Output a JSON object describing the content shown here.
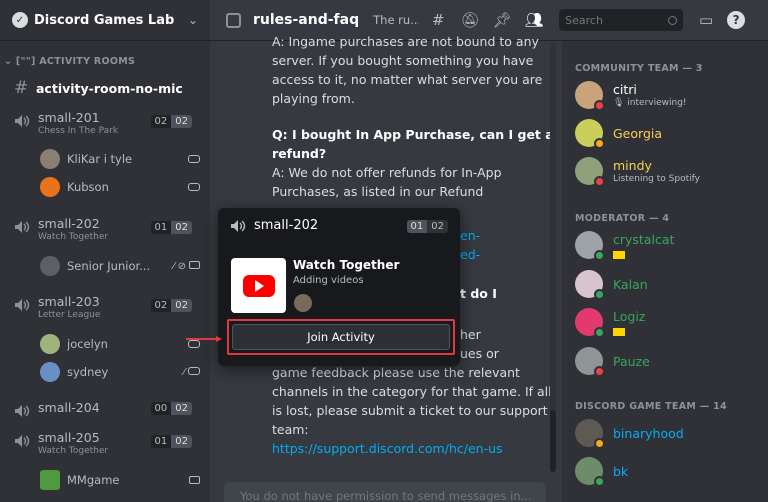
{
  "sidebar": {
    "server_name": "Discord Games Lab",
    "category": "ACTIVITY ROOMS",
    "category_prefix": "[\"\"]",
    "text_channel": "activity-room-no-mic",
    "voice_channels": [
      {
        "name": "small-201",
        "subtitle": "Chess In The Park",
        "count_a": "02",
        "count_b": "02",
        "users": [
          {
            "name": "KliKar i tyle"
          },
          {
            "name": "Kubson"
          }
        ]
      },
      {
        "name": "small-202",
        "subtitle": "Watch Together",
        "count_a": "01",
        "count_b": "02",
        "users": [
          {
            "name": "Senior Junior..."
          }
        ]
      },
      {
        "name": "small-203",
        "subtitle": "Letter League",
        "count_a": "02",
        "count_b": "02",
        "users": [
          {
            "name": "jocelyn"
          },
          {
            "name": "sydney"
          }
        ]
      },
      {
        "name": "small-204",
        "subtitle": "",
        "count_a": "00",
        "count_b": "02",
        "users": []
      },
      {
        "name": "small-205",
        "subtitle": "Watch Together",
        "count_a": "01",
        "count_b": "02",
        "users": [
          {
            "name": "MMgame"
          }
        ]
      }
    ]
  },
  "topbar": {
    "channel_name": "rules-and-faq",
    "topic": "The ru...",
    "search_placeholder": "Search"
  },
  "messages": {
    "p1": "A: Ingame purchases are not bound to any server. If you bought something you have access to it, no matter what server you are playing from.",
    "q2": "Q: I bought In App Purchase, can I get a refund?",
    "a2": "A: We do not offer refunds for In-App Purchases, as listed in our Refund",
    "frag_link1": "en-",
    "frag_link2": "ed-",
    "frag_q3": "t do I",
    "frag_l1": "her",
    "frag_l2": "ues or",
    "p3": "game feedback please use the relevant channels in the category for that game. If all is lost, please submit a ticket to our support team:",
    "link": "https://support.discord.com/hc/en-us",
    "composer_placeholder": "You do not have permission to send messages in..."
  },
  "members": {
    "groups": [
      {
        "label": "COMMUNITY TEAM — 3",
        "members": [
          {
            "name": "citri",
            "status": "interviewing!",
            "color": "#ffffff"
          },
          {
            "name": "Georgia",
            "status": "",
            "color": "#f9d057"
          },
          {
            "name": "mindy",
            "status": "Listening to Spotify",
            "color": "#f9d057"
          }
        ]
      },
      {
        "label": "MODERATOR — 4",
        "members": [
          {
            "name": "crystalcat",
            "color": "#3ba55d"
          },
          {
            "name": "Kalan",
            "color": "#3ba55d"
          },
          {
            "name": "Logiz",
            "color": "#3ba55d"
          },
          {
            "name": "Pauze",
            "color": "#3ba55d"
          }
        ]
      },
      {
        "label": "DISCORD GAME TEAM — 14",
        "members": [
          {
            "name": "binaryhood",
            "color": "#00aff4"
          },
          {
            "name": "bk",
            "color": "#00aff4"
          }
        ]
      }
    ]
  },
  "popup": {
    "channel": "small-202",
    "count_a": "01",
    "count_b": "02",
    "activity_title": "Watch Together",
    "activity_sub": "Adding videos",
    "join_label": "Join Activity"
  },
  "colors": {
    "highlight": "#e03a3e",
    "link": "#00aff4",
    "online": "#3ba55d",
    "dnd": "#ed4245"
  }
}
